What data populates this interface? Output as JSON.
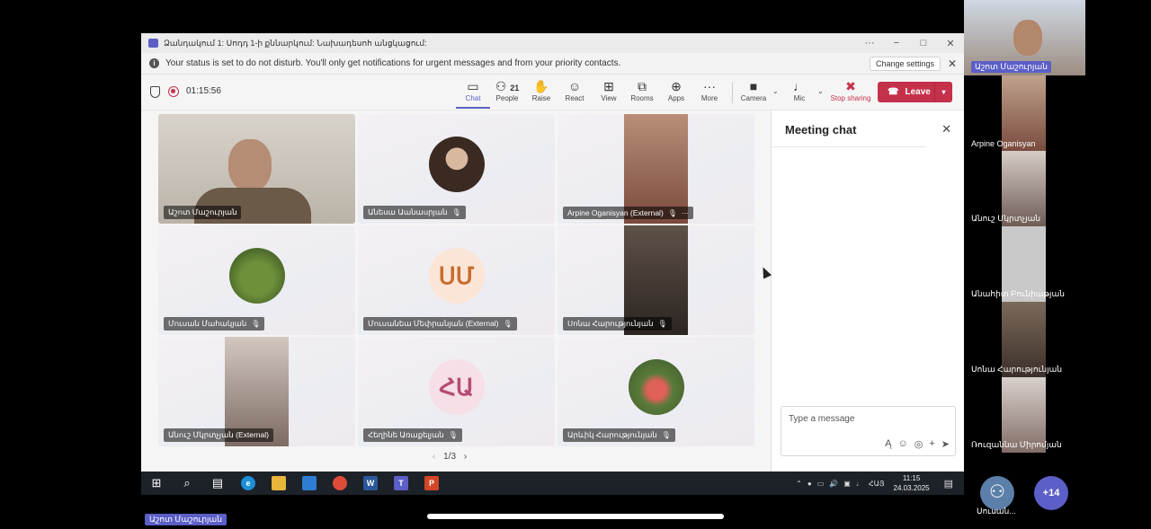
{
  "window": {
    "title": "Ձանդակում 1: Սոդդ 1-ի քննարկում: Նախադեսոհ անցկացում:",
    "minimize_icon": "−",
    "maximize_icon": "□",
    "close_icon": "✕",
    "more_icon": "···"
  },
  "notice": {
    "text": "Your status is set to do not disturb. You'll only get notifications for urgent messages and from your priority contacts.",
    "change_settings": "Change settings"
  },
  "meeting": {
    "timer": "01:15:56",
    "toolbar": [
      {
        "label": "Chat",
        "icon": "chat-icon",
        "glyph": "💬"
      },
      {
        "label": "People",
        "icon": "people-icon",
        "glyph": "👥",
        "count": "21"
      },
      {
        "label": "Raise",
        "icon": "hand-icon",
        "glyph": "✋"
      },
      {
        "label": "React",
        "icon": "smile-icon",
        "glyph": "☺"
      },
      {
        "label": "View",
        "icon": "grid-icon",
        "glyph": "⊞"
      },
      {
        "label": "Rooms",
        "icon": "rooms-icon",
        "glyph": "⧉"
      },
      {
        "label": "Apps",
        "icon": "apps-icon",
        "glyph": "⊕"
      },
      {
        "label": "More",
        "icon": "more-icon",
        "glyph": "···"
      },
      {
        "label": "Camera",
        "icon": "camera-icon",
        "glyph": "■"
      },
      {
        "label": "Mic",
        "icon": "mic-icon",
        "glyph": "🎙"
      },
      {
        "label": "Stop sharing",
        "icon": "stop-share-icon",
        "glyph": "✖"
      }
    ],
    "leave": "Leave"
  },
  "tiles": [
    {
      "name": "Աշոտ Մաշուրյան",
      "muted": false
    },
    {
      "name": "Անեսա Աանասրյան",
      "muted": true
    },
    {
      "name": "Arpine Oganisyan (External)",
      "muted": true
    },
    {
      "name": "Մուսան Մահակյան",
      "muted": true
    },
    {
      "name": "Մուսանեա Մեփրանյան (External)",
      "muted": true,
      "initials": "ՍՄ"
    },
    {
      "name": "Սոնա Հարությունյան",
      "muted": true
    },
    {
      "name": "Անուշ Մկրտչյան (External)",
      "muted": false
    },
    {
      "name": "Հեղինե Առաքելյան",
      "muted": true,
      "initials": "ՀԱ"
    },
    {
      "name": "Արևիկ Հարությունյան",
      "muted": true
    }
  ],
  "pager": {
    "text": "1/3"
  },
  "chat": {
    "title": "Meeting chat",
    "placeholder": "Type a message"
  },
  "taskbar": {
    "time": "11:15",
    "date": "24.03.2025",
    "lang": "ՀԱՅ"
  },
  "side_participants": [
    {
      "name": "Աշոտ Մաշուրյան",
      "highlight": true
    },
    {
      "name": "Arpine Oganisyan",
      "highlight": false
    },
    {
      "name": "Անուշ Մկրտչյան",
      "highlight": false
    },
    {
      "name": "Անահիտ Բունիաթյան",
      "highlight": false
    },
    {
      "name": "Սոնա Հարությունյան",
      "highlight": false
    },
    {
      "name": "Ռուզաննա Միրոմյան",
      "highlight": false
    }
  ],
  "overflow": {
    "count": "+14",
    "self_label": "Սուսան..."
  },
  "bottom_label": "Աշոտ Մաշուրյան",
  "colors": {
    "accent": "#5b5fc7",
    "leave": "#c4314b"
  }
}
